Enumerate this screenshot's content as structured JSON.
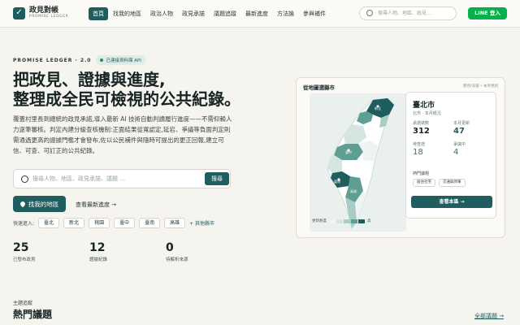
{
  "nav": {
    "logo_title": "政見對帳",
    "logo_sub": "PROMISE LEDGER",
    "logo_icon": "check-icon",
    "items": [
      "首頁",
      "找我的地區",
      "政治人物",
      "政見承諾",
      "議題追蹤",
      "最新進度",
      "方法論",
      "參與補件"
    ],
    "active_index": 0,
    "search_placeholder": "搜尋人物、地區、政見…",
    "line_button": "LINE 登入"
  },
  "hero": {
    "eyebrow": "PROMISE LEDGER · 2.0",
    "badge": "已連接資料庫 API",
    "headline_line1": "把政見、證據與進度,",
    "headline_line2": "整理成全民可檢視的公共紀錄。",
    "intro": "覆蓋村里長到總統的政見承諾,導入最新 AI 技術自動判讀履行進度——不需仰賴人力逐筆審核。判定內建分級查核機制:正面結果從寬認定,延宕、爭議等負面判定則需通過更高的證據門檻才會發布,佐以公民補件與隨時可提出的更正回報,建立可信、可查、可訂正的公共紀錄。",
    "search_placeholder": "搜尋人物、地區、政見承諾、議題 …",
    "search_button": "搜尋",
    "primary_button": "找我的地區",
    "secondary_link": "查看最新進度 →",
    "quick_label": "快速進入:",
    "quick_cities": [
      "臺北",
      "新北",
      "桃園",
      "臺中",
      "臺南",
      "高雄"
    ],
    "more_cities": "+ 其他縣市",
    "stats": [
      {
        "value": "25",
        "label": "已發布政見"
      },
      {
        "value": "12",
        "label": "證據紀錄"
      },
      {
        "value": "0",
        "label": "待解析來源"
      }
    ]
  },
  "map_card": {
    "title": "從地圖選縣市",
    "hint": "懸停/深選 • 本月更新",
    "legend_label": "更新熱度",
    "legend_colors": [
      "#eef4f2",
      "#d5e6e1",
      "#a9cdc4",
      "#5f9e93",
      "#1f5d5e"
    ],
    "legend_end": "高",
    "map_labels": {
      "north": "新北",
      "taichung": "臺中",
      "tainan": "臺南",
      "kaohsiung": "高雄"
    },
    "detail": {
      "city": "臺北市",
      "sub": "北市 · 本月概況",
      "metrics": [
        {
          "label": "承諾總數",
          "value": "312"
        },
        {
          "label": "本月更新",
          "value": "47"
        },
        {
          "label": "待查證",
          "value": "18"
        },
        {
          "label": "爭議中",
          "value": "4"
        }
      ],
      "hot_label": "熱門議題",
      "tags": [
        "居住社宅",
        "交通與停車"
      ],
      "button": "查看本區 →"
    }
  },
  "section": {
    "eyebrow": "主題追蹤",
    "title": "熱門議題",
    "link": "全部議題 →"
  },
  "colors": {
    "primary": "#1f5d5e",
    "line_green": "#06b04a",
    "background": "#f6f4ef"
  }
}
